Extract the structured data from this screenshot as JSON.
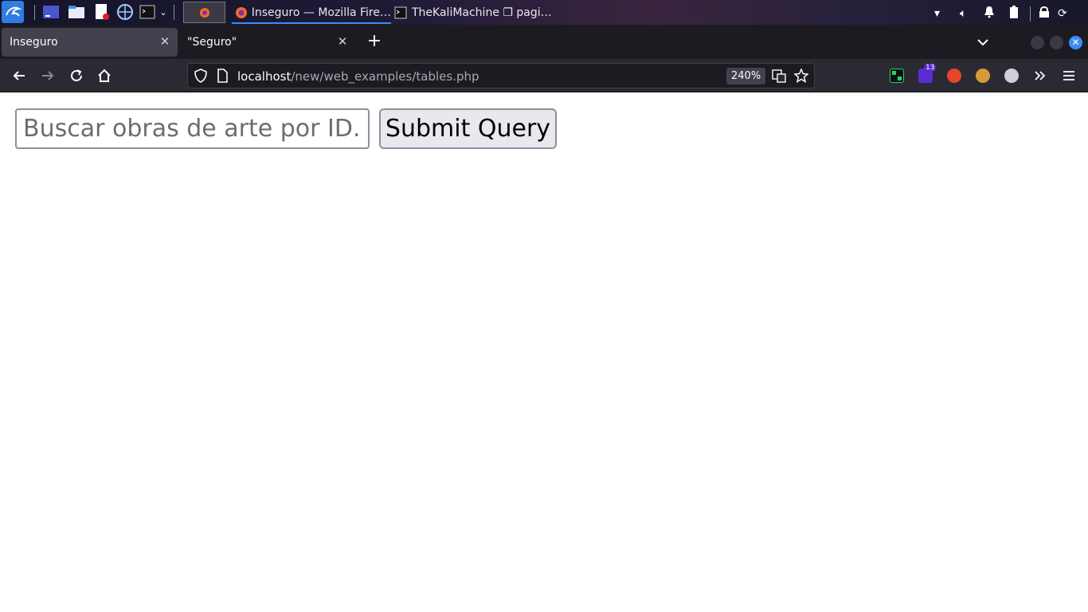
{
  "taskbar": {
    "windows": [
      {
        "label": "Inseguro — Mozilla Fire…",
        "icon": "firefox-icon",
        "active": true
      },
      {
        "label": "TheKaliMachine ❐ pagi…",
        "icon": "terminal-icon",
        "active": false
      }
    ]
  },
  "browser": {
    "tabs": [
      {
        "title": "Inseguro",
        "active": true
      },
      {
        "title": "\"Seguro\"",
        "active": false
      }
    ],
    "url_host": "localhost",
    "url_path": "/new/web_examples/tables.php",
    "zoom": "240%",
    "extension_badge": "13"
  },
  "page": {
    "search_placeholder": "Buscar obras de arte por ID...",
    "submit_label": "Submit Query"
  },
  "colors": {
    "accent": "#3d8df5",
    "toolbar": "#2b2a33",
    "tabstrip": "#1c1b22"
  }
}
